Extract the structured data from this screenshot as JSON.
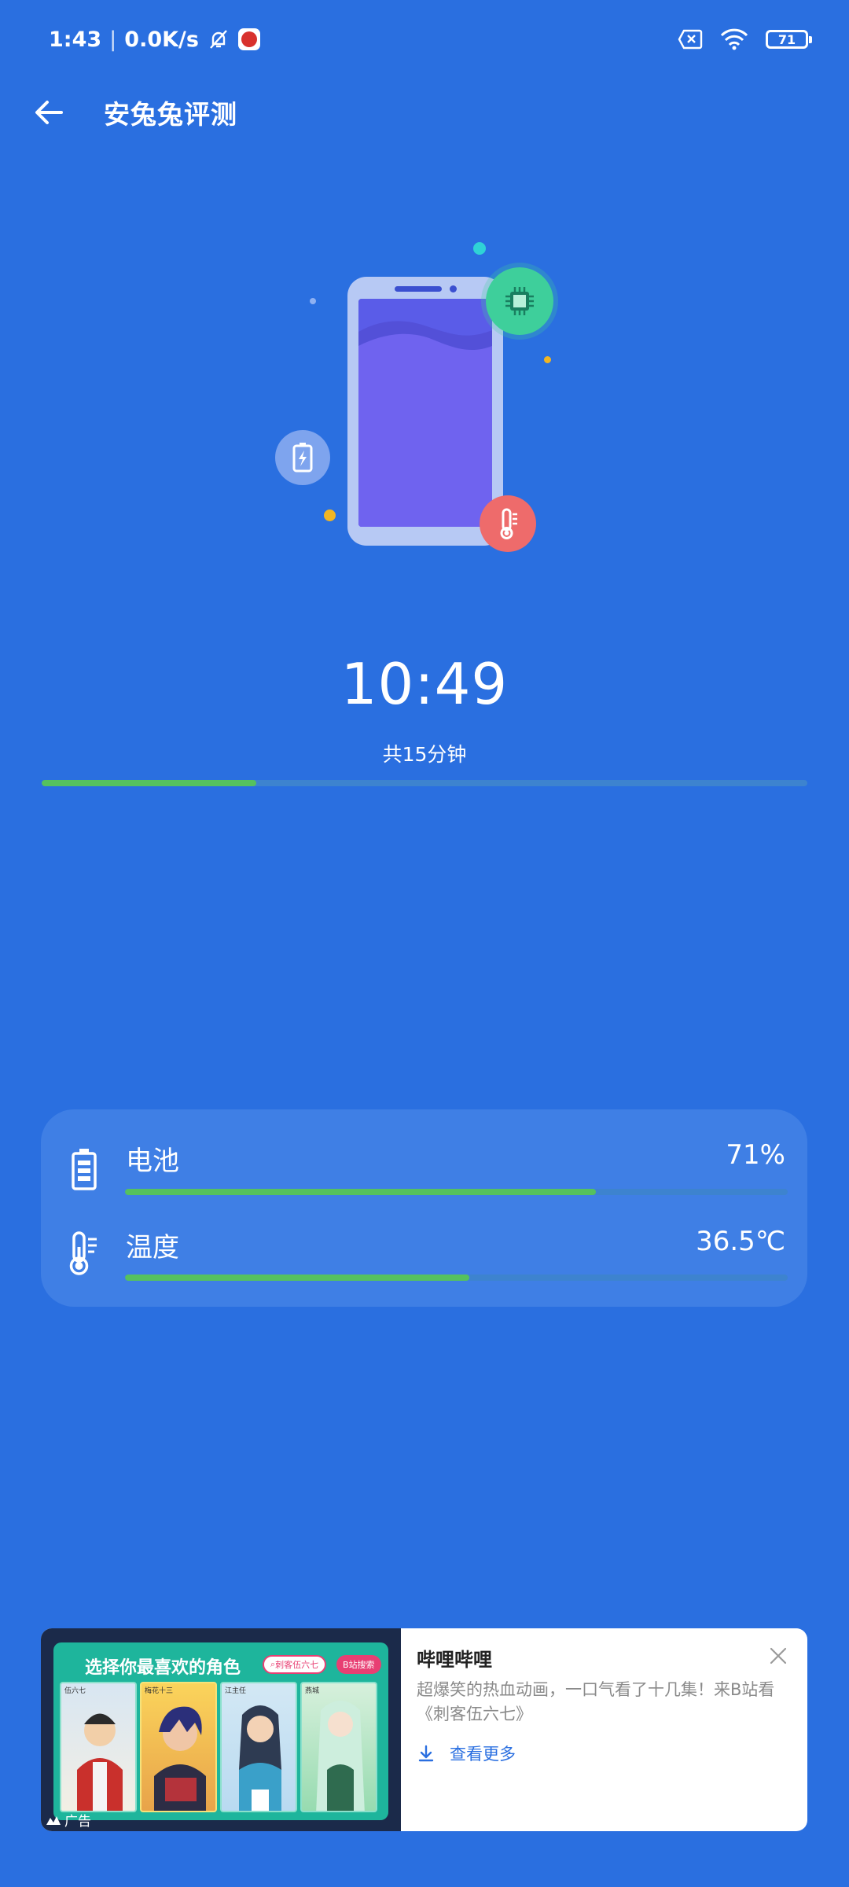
{
  "status_bar": {
    "time": "1:43",
    "net_speed": "0.0K/s",
    "battery_level": "71"
  },
  "header": {
    "title": "安兔兔评测"
  },
  "illustration": {
    "icons": [
      "battery-charging-icon",
      "chip-icon",
      "thermometer-icon"
    ],
    "colors": {
      "phone_body": "#b7c9f4",
      "screen": "#5a5ce8",
      "chip_badge": "#3ecf9b",
      "thermo_badge": "#ee6b6b"
    }
  },
  "timer": {
    "value": "10:49",
    "total_label": "共15分钟",
    "progress": 0.28
  },
  "stats": {
    "battery": {
      "label": "电池",
      "value": "71%",
      "progress": 0.71
    },
    "temperature": {
      "label": "温度",
      "value": "36.5℃",
      "progress": 0.52
    }
  },
  "ad": {
    "banner_title": "选择你最喜欢的角色",
    "banner_search": "刺客伍六七",
    "banner_search_btn": "B站搜索",
    "characters": [
      "伍六七",
      "梅花十三",
      "江主任",
      "燕城"
    ],
    "tag": "广告",
    "title": "哔哩哔哩",
    "description": "超爆笑的热血动画，一口气看了十几集！来B站看《刺客伍六七》",
    "more_label": "查看更多"
  },
  "colors": {
    "background": "#2a6fe0",
    "progress_fill": "#55c15f",
    "progress_track": "#3d83cf",
    "card": "#3f7fe5"
  }
}
